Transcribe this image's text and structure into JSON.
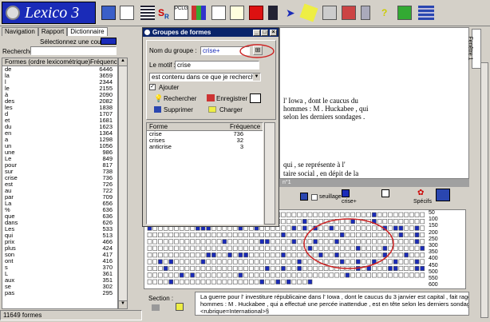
{
  "app": {
    "logo_text": "Lexico 3"
  },
  "tabs": [
    {
      "label": "Navigation"
    },
    {
      "label": "Rapport"
    },
    {
      "label": "Dictionnaire"
    }
  ],
  "left": {
    "select_color_label": "Sélectionnez une couleur :",
    "search_label": "Recherche :",
    "search_value": "",
    "col_form": "Formes (ordre lexicométrique)",
    "col_freq": "Fréquence",
    "rows": [
      [
        "de",
        "6446"
      ],
      [
        "la",
        "3659"
      ],
      [
        "l",
        "2344"
      ],
      [
        "le",
        "2155"
      ],
      [
        "à",
        "2090"
      ],
      [
        "des",
        "2082"
      ],
      [
        "les",
        "1838"
      ],
      [
        "d",
        "1707"
      ],
      [
        "et",
        "1681"
      ],
      [
        "du",
        "1623"
      ],
      [
        "en",
        "1364"
      ],
      [
        "a",
        "1298"
      ],
      [
        "un",
        "1056"
      ],
      [
        "une",
        "986"
      ],
      [
        "Le",
        "849"
      ],
      [
        "pour",
        "817"
      ],
      [
        "sur",
        "738"
      ],
      [
        "crise",
        "736"
      ],
      [
        "est",
        "726"
      ],
      [
        "au",
        "722"
      ],
      [
        "par",
        "709"
      ],
      [
        "La",
        "656"
      ],
      [
        "%",
        "636"
      ],
      [
        "que",
        "636"
      ],
      [
        "dans",
        "626"
      ],
      [
        "Les",
        "533"
      ],
      [
        "qui",
        "513"
      ],
      [
        "prix",
        "466"
      ],
      [
        "plus",
        "424"
      ],
      [
        "son",
        "417"
      ],
      [
        "ont",
        "416"
      ],
      [
        "s",
        "370"
      ],
      [
        "L",
        "361"
      ],
      [
        "aux",
        "351"
      ],
      [
        "se",
        "302"
      ],
      [
        "pas",
        "295"
      ]
    ],
    "status": "11649 formes"
  },
  "dialog": {
    "title": "Groupes de formes",
    "group_label": "Nom du groupe :",
    "group_value": "crise+",
    "motif_label": "Le motif :",
    "motif_value": "crise",
    "mode_value": "est contenu dans ce que je recherche",
    "add_label": "Ajouter",
    "search_btn": "Rechercher",
    "save_btn": "Enregistrer",
    "delete_btn": "Supprimer",
    "load_btn": "Charger",
    "col_form": "Forme",
    "col_freq": "Fréquence",
    "rows": [
      [
        "crise",
        "736"
      ],
      [
        "crises",
        "32"
      ],
      [
        "anticrise",
        "3"
      ]
    ]
  },
  "document": {
    "lines": [
      "l' Iowa , dont le caucus du",
      "hommes : M . Huckabee , qui",
      "selon les derniers sondages .",
      "",
      "",
      "",
      "qui , se représente à l'",
      "taire social , en dépit de la"
    ]
  },
  "map": {
    "title": "n°1",
    "threshold_label": "seuillage",
    "group_label": "crise+",
    "specifs_label": "Spécifs",
    "scale": [
      "50",
      "100",
      "150",
      "200",
      "250",
      "300",
      "350",
      "400",
      "450",
      "500",
      "550",
      "600"
    ]
  },
  "bottom": {
    "section_label": "Section :",
    "context_lines": [
      "La guerre pour l' investiture républicaine dans l' Iowa , dont le caucus du 3 janvier est capital , fait rage entre les deux",
      "hommes : M . Huckabee , qui a effectué une percée inattendue , est en tête selon les derniers sondages .",
      "<rubrique=International>§"
    ]
  },
  "right_tab": {
    "label": "Fenêtre 1"
  },
  "colors": {
    "titlebar": "#0a246a",
    "highlight": "#1a2bb8",
    "ellipse": "#cc2222"
  }
}
